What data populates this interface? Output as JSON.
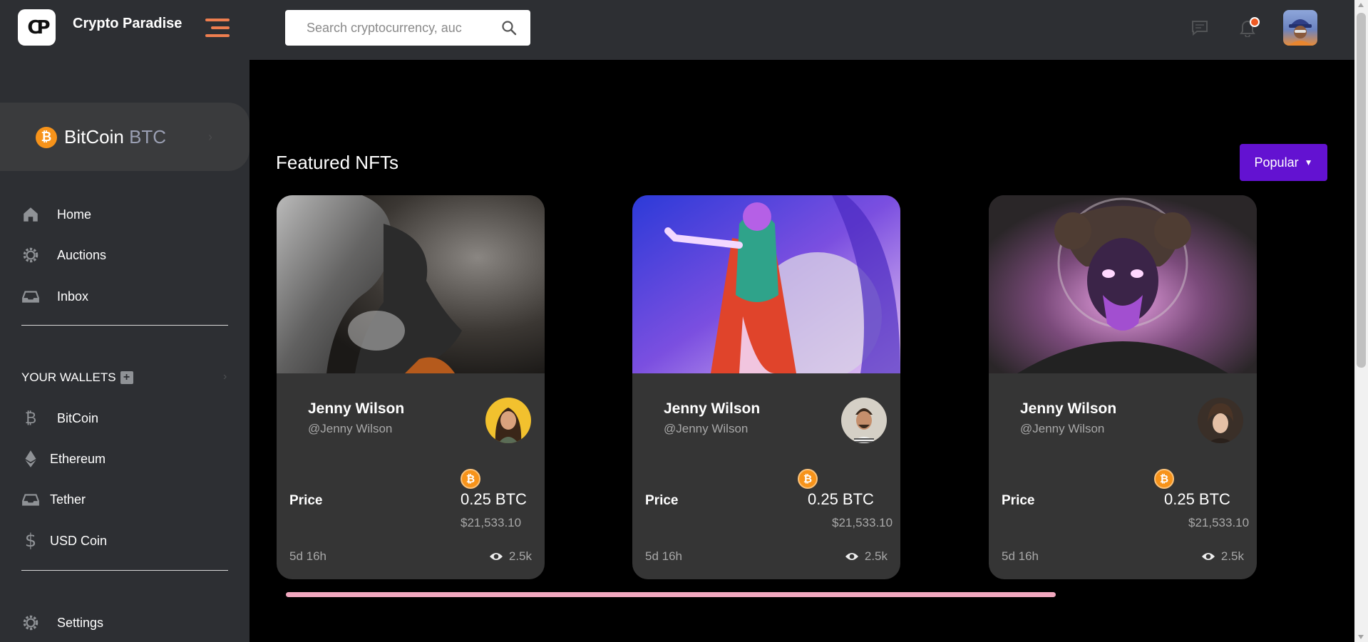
{
  "header": {
    "brand": "Crypto Paradise",
    "logo_text": "CP",
    "search_placeholder": "Search cryptocurrency, auc"
  },
  "sidebar": {
    "coin": {
      "name": "BitCoin",
      "symbol": "BTC"
    },
    "nav": [
      {
        "label": "Home",
        "icon": "home-icon"
      },
      {
        "label": "Auctions",
        "icon": "gear-icon"
      },
      {
        "label": "Inbox",
        "icon": "inbox-icon"
      }
    ],
    "wallets_title": "YOUR WALLETS",
    "wallets": [
      {
        "label": "BitCoin",
        "icon": "bitcoin-icon"
      },
      {
        "label": "Ethereum",
        "icon": "ethereum-icon"
      },
      {
        "label": "Tether",
        "icon": "tether-icon"
      },
      {
        "label": "USD Coin",
        "icon": "dollar-icon"
      }
    ],
    "settings": "Settings"
  },
  "main": {
    "title": "Featured NFTs",
    "filter_label": "Popular",
    "cards": [
      {
        "name": "Jenny Wilson",
        "handle": "@Jenny Wilson",
        "price_label": "Price",
        "price_btc": "0.25 BTC",
        "price_usd": "$21,533.10",
        "time_left": "5d 16h",
        "views": "2.5k"
      },
      {
        "name": "Jenny Wilson",
        "handle": "@Jenny Wilson",
        "price_label": "Price",
        "price_btc": "0.25 BTC",
        "price_usd": "$21,533.10",
        "time_left": "5d 16h",
        "views": "2.5k"
      },
      {
        "name": "Jenny Wilson",
        "handle": "@Jenny Wilson",
        "price_label": "Price",
        "price_btc": "0.25 BTC",
        "price_usd": "$21,533.10",
        "time_left": "5d 16h",
        "views": "2.5k"
      }
    ]
  },
  "colors": {
    "accent": "#6312d1",
    "sidebar_bg": "#2d2f33",
    "card_bg": "#353535",
    "hamburger": "#ee7e4f",
    "bitcoin": "#f7931a",
    "scroll_track": "#f2a8bf"
  }
}
